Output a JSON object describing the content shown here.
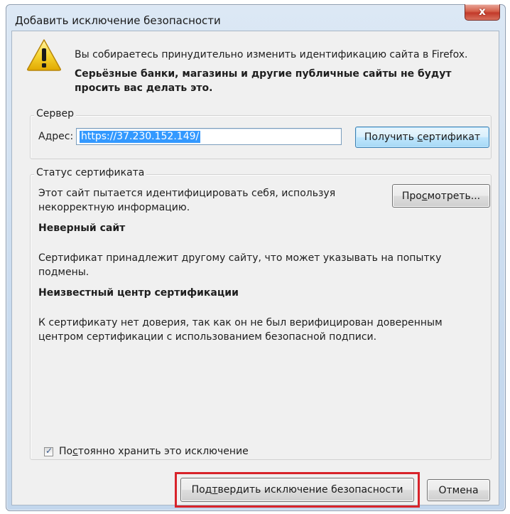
{
  "window": {
    "title": "Добавить исключение безопасности",
    "close_label": "x"
  },
  "message": {
    "line1": "Вы собираетесь принудительно изменить идентификацию сайта в Firefox.",
    "line2": "Серьёзные банки, магазины и другие публичные сайты не будут просить вас делать это."
  },
  "server": {
    "legend": "Сервер",
    "address_label_pre": "А",
    "address_label_accel": "д",
    "address_label_post": "рес:",
    "address_value": "https://37.230.152.149/",
    "get_cert_pre": "Получить ",
    "get_cert_accel": "с",
    "get_cert_post": "ертификат"
  },
  "status": {
    "legend": "Статус сертификата",
    "intro": "Этот сайт пытается идентифицировать себя, используя некорректную информацию.",
    "view_pre": "Про",
    "view_accel": "с",
    "view_post": "мотреть...",
    "wrong_site_title": "Неверный сайт",
    "wrong_site_desc": "Сертификат принадлежит другому сайту, что может указывать на попытку подмены.",
    "unknown_ca_title": "Неизвестный центр сертификации",
    "unknown_ca_desc": "К сертификату нет доверия, так как он не был верифицирован доверенным центром сертификации с использованием безопасной подписи."
  },
  "permanent": {
    "checked": true,
    "label_pre": "По",
    "label_accel": "с",
    "label_post": "тоянно хранить это исключение"
  },
  "actions": {
    "confirm_pre": "Под",
    "confirm_accel": "т",
    "confirm_post": "вердить исключение безопасности",
    "cancel_label": "Отмена"
  },
  "colors": {
    "highlight_border": "#d8232a",
    "selection": "#3399ff",
    "warning_fill": "#f7d633"
  },
  "icons": {
    "warning": "warning-triangle-icon",
    "close": "close-icon",
    "check": "check-icon"
  }
}
